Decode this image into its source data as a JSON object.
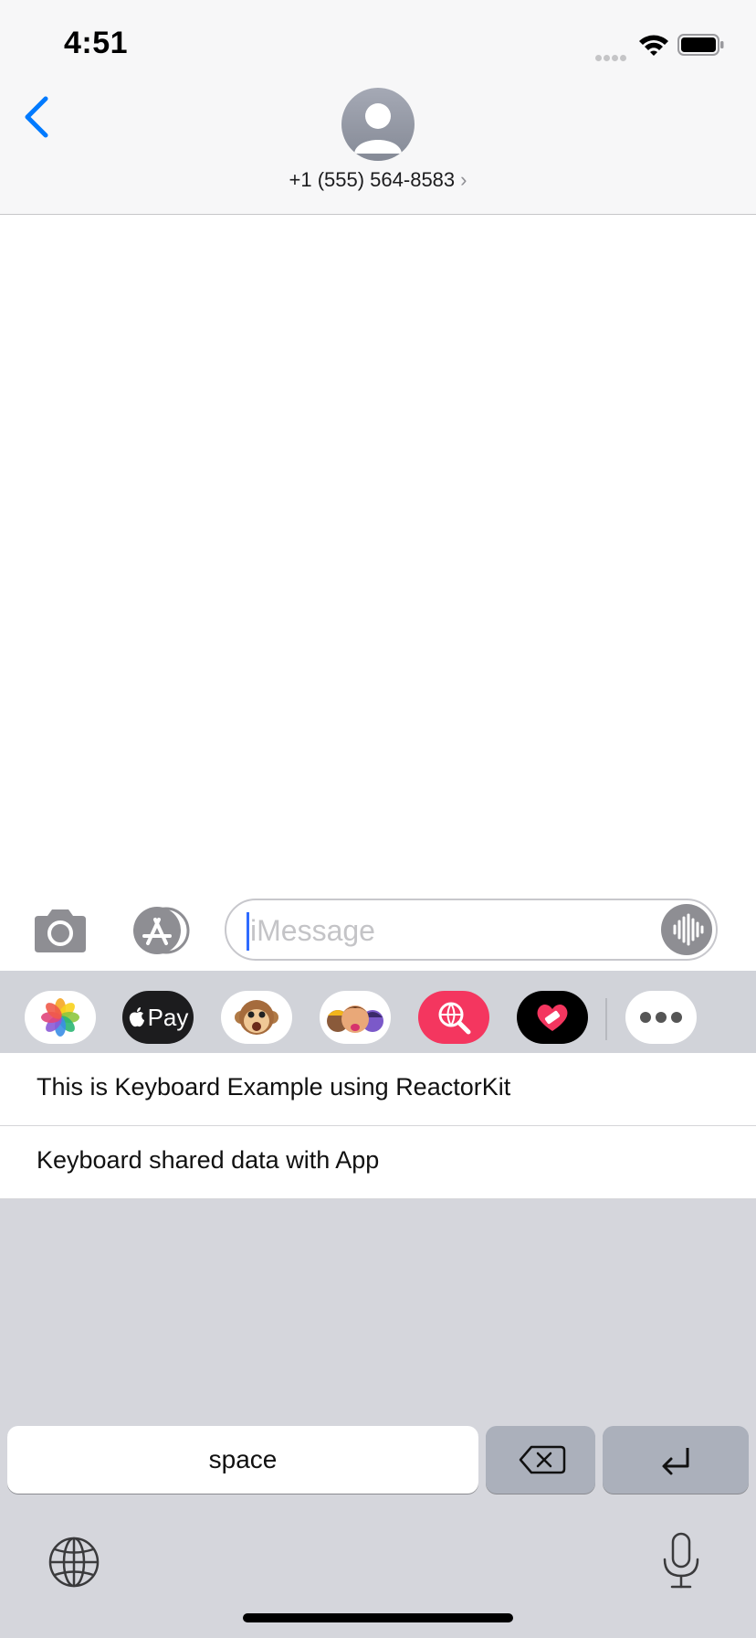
{
  "status_bar": {
    "time": "4:51"
  },
  "header": {
    "contact": "+1 (555) 564-8583",
    "contact_chevron": "›"
  },
  "compose": {
    "placeholder": "iMessage"
  },
  "app_drawer": {
    "apps": [
      "photos-icon",
      "apple-pay-icon",
      "animoji-icon",
      "memoji-icon",
      "web-search-icon",
      "heart-sticker-icon",
      "more-icon"
    ],
    "apple_pay_label": "Pay"
  },
  "suggestions": [
    "This is Keyboard Example using ReactorKit",
    "Keyboard shared data with App"
  ],
  "keyboard": {
    "space_label": "space"
  },
  "colors": {
    "accent": "#007aff",
    "header_bg": "#f7f7f8",
    "keyboard_bg": "#d5d6dc"
  }
}
